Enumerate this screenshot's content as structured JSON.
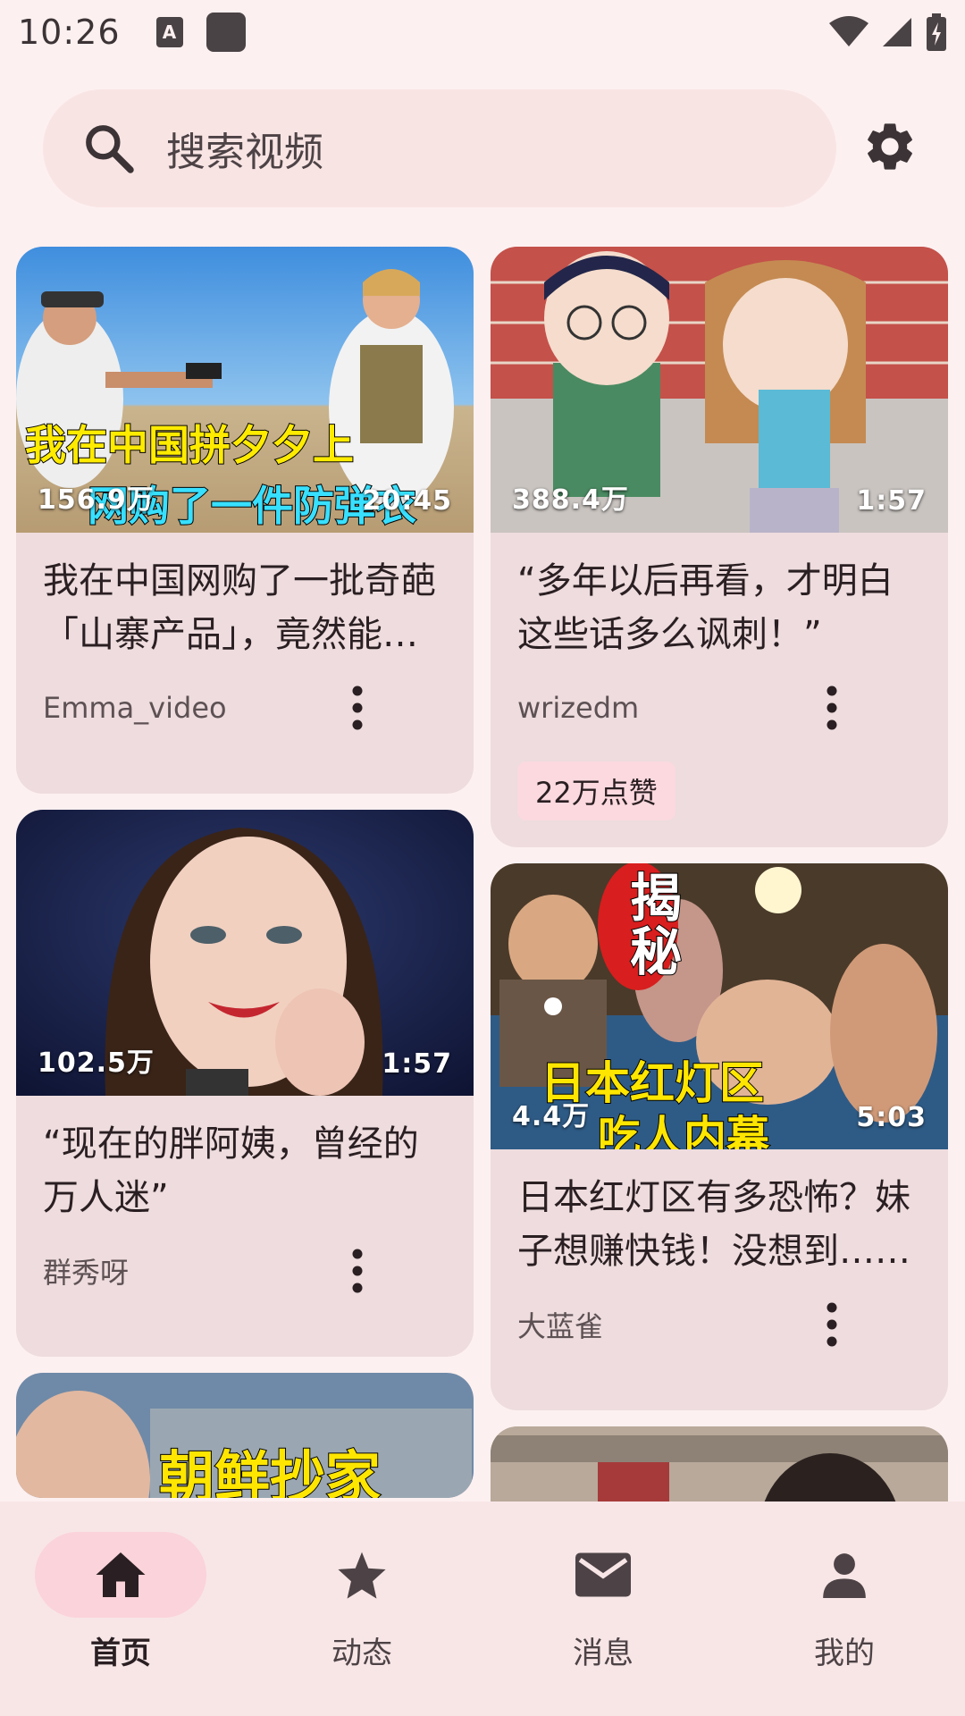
{
  "status_bar": {
    "time": "10:26",
    "note_icon": "keyboard-a-icon",
    "wifi_icon": "wifi-icon",
    "signal_icon": "signal-icon",
    "battery_icon": "battery-icon"
  },
  "search": {
    "placeholder": "搜索视频",
    "search_icon": "search-icon",
    "settings_icon": "gear-icon"
  },
  "feed": {
    "left": [
      {
        "views": "156.9万",
        "duration": "20:45",
        "overlay_line1": "我在中国拼夕夕上",
        "overlay_line2": "网购了一件防弹衣",
        "title": "我在中国网购了一批奇葩「山寨产品」，竟然能用上？",
        "author": "Emma_video"
      },
      {
        "views": "102.5万",
        "duration": "1:57",
        "title": "“现在的胖阿姨，曾经的万人迷”",
        "author": "群秀呀"
      },
      {
        "overlay_text": "朝鲜抄家"
      }
    ],
    "right": [
      {
        "views": "388.4万",
        "duration": "1:57",
        "title": "“多年以后再看，才明白这些话多么讽刺！”",
        "author": "wrizedm",
        "likes": "22万点赞"
      },
      {
        "views": "4.4万",
        "duration": "5:03",
        "overlay_vertical": "揭秘",
        "overlay_line1": "日本红灯区",
        "overlay_line2": "吃人内幕",
        "title": "日本红灯区有多恐怖？妹子想赚快钱！没想到……",
        "author": "大蓝雀"
      },
      {}
    ]
  },
  "bottom_nav": [
    {
      "label": "首页",
      "icon": "home-icon",
      "active": true
    },
    {
      "label": "动态",
      "icon": "star-icon",
      "active": false
    },
    {
      "label": "消息",
      "icon": "mail-icon",
      "active": false
    },
    {
      "label": "我的",
      "icon": "person-icon",
      "active": false
    }
  ],
  "colors": {
    "background": "#fdf0f0",
    "card": "#eedcde",
    "active_pill": "#fbd3da",
    "like_badge": "#fbd9df"
  }
}
